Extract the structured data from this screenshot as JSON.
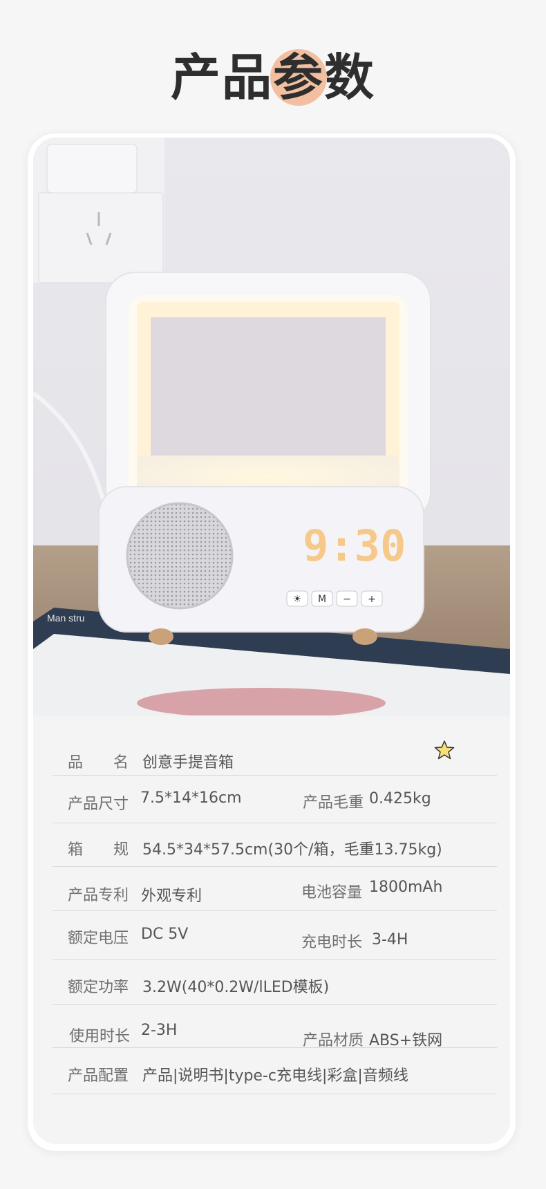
{
  "header": {
    "title_part1": "产品",
    "title_highlight": "参",
    "title_part2": "数"
  },
  "photo": {
    "clock_time": "9:30",
    "buttons": [
      "☀",
      "M",
      "−",
      "+"
    ],
    "book_text": "Man stru"
  },
  "specs": [
    {
      "label": "品　　名",
      "value": "创意手提音箱"
    },
    {
      "label": "产品尺寸",
      "value": "7.5*14*16cm"
    },
    {
      "label": "产品毛重",
      "value": "0.425kg"
    },
    {
      "label": "箱　　规",
      "value": "54.5*34*57.5cm(30个/箱，毛重13.75kg)"
    },
    {
      "label": "产品专利",
      "value": "外观专利"
    },
    {
      "label": "电池容量",
      "value": "1800mAh"
    },
    {
      "label": "额定电压",
      "value": "DC 5V"
    },
    {
      "label": "充电时长",
      "value": "3-4H"
    },
    {
      "label": "额定功率",
      "value": "3.2W(40*0.2W/lLED模板)"
    },
    {
      "label": "使用时长",
      "value": "2-3H"
    },
    {
      "label": "产品材质",
      "value": "ABS+铁网"
    },
    {
      "label": "产品配置",
      "value": "产品|说明书|type-c充电线|彩盒|音频线"
    }
  ]
}
